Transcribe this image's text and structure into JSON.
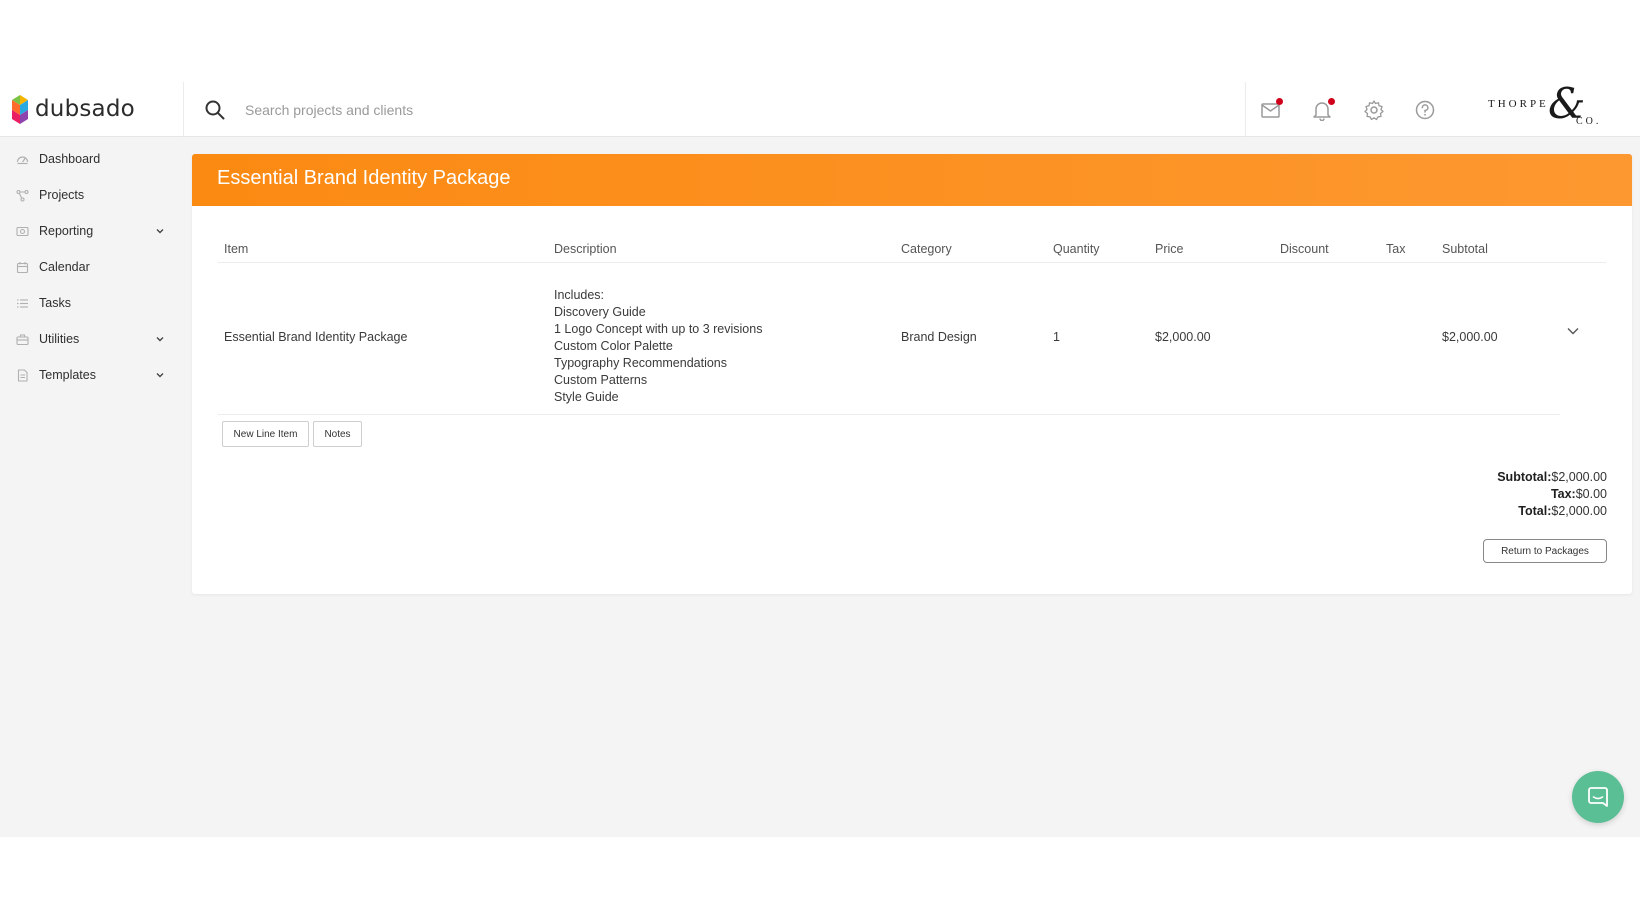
{
  "app": {
    "logo_text": "dubsado",
    "search_placeholder": "Search projects and clients",
    "brand": {
      "line1": "THORPE",
      "ampersand": "&",
      "line2": "CO."
    },
    "top_icons": [
      "mail-icon",
      "bell-icon",
      "gear-icon",
      "help-icon"
    ]
  },
  "sidebar": {
    "items": [
      {
        "label": "Dashboard",
        "icon": "dashboard-icon",
        "has_chevron": false
      },
      {
        "label": "Projects",
        "icon": "projects-icon",
        "has_chevron": false
      },
      {
        "label": "Reporting",
        "icon": "reporting-icon",
        "has_chevron": true
      },
      {
        "label": "Calendar",
        "icon": "calendar-icon",
        "has_chevron": false
      },
      {
        "label": "Tasks",
        "icon": "tasks-icon",
        "has_chevron": false
      },
      {
        "label": "Utilities",
        "icon": "utilities-icon",
        "has_chevron": true
      },
      {
        "label": "Templates",
        "icon": "templates-icon",
        "has_chevron": true
      }
    ]
  },
  "package": {
    "title": "Essential Brand Identity Package",
    "accent_color": "#fb8a12",
    "columns": [
      "Item",
      "Description",
      "Category",
      "Quantity",
      "Price",
      "Discount",
      "Tax",
      "Subtotal"
    ],
    "line_item": {
      "item": "Essential Brand Identity Package",
      "description": [
        "Includes:",
        "Discovery Guide",
        "1 Logo Concept with up to 3 revisions",
        "Custom Color Palette",
        "Typography Recommendations",
        "Custom Patterns",
        "Style Guide"
      ],
      "category": "Brand Design",
      "quantity": "1",
      "price": "$2,000.00",
      "discount": "",
      "tax": "",
      "subtotal": "$2,000.00"
    },
    "buttons": {
      "new_line_item": "New Line Item",
      "notes": "Notes",
      "return": "Return to Packages"
    },
    "totals": {
      "subtotal_label": "Subtotal:",
      "subtotal_value": "$2,000.00",
      "tax_label": "Tax:",
      "tax_value": "$0.00",
      "total_label": "Total:",
      "total_value": "$2,000.00"
    }
  }
}
